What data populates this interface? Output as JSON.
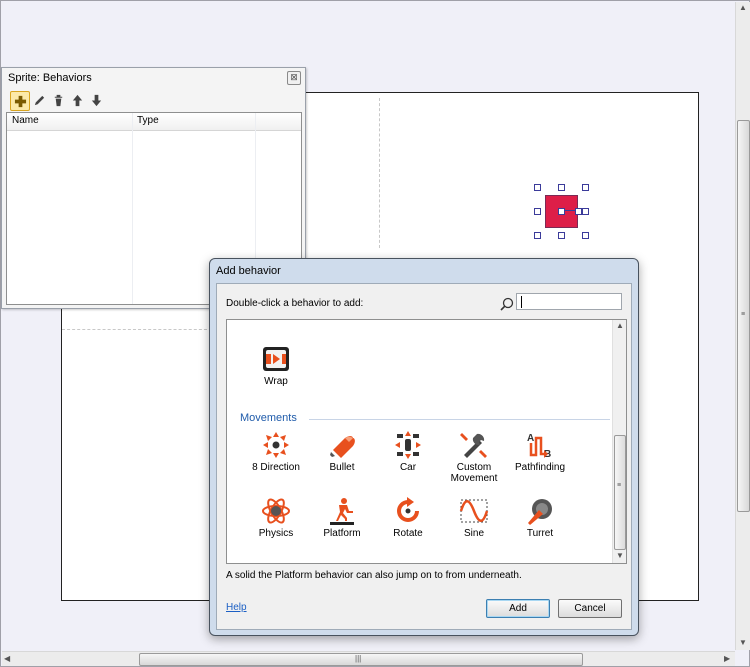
{
  "panel": {
    "title": "Sprite: Behaviors",
    "close_glyph": "⊠",
    "toolbar": [
      {
        "name": "add-icon"
      },
      {
        "name": "edit-icon"
      },
      {
        "name": "delete-icon"
      },
      {
        "name": "move-up-icon"
      },
      {
        "name": "move-down-icon"
      }
    ],
    "columns": [
      "Name",
      "Type"
    ]
  },
  "dialog": {
    "title": "Add behavior",
    "prompt": "Double-click a behavior to add:",
    "search_value": "",
    "top_items": [
      {
        "label": "Wrap",
        "icon": "wrap-icon"
      }
    ],
    "category": "Movements",
    "items": [
      {
        "label": "8 Direction",
        "icon": "eight-direction-icon"
      },
      {
        "label": "Bullet",
        "icon": "bullet-icon"
      },
      {
        "label": "Car",
        "icon": "car-icon"
      },
      {
        "label": "Custom Movement",
        "line1": "Custom",
        "line2": "Movement",
        "icon": "custom-movement-icon"
      },
      {
        "label": "Pathfinding",
        "icon": "pathfinding-icon"
      },
      {
        "label": "Physics",
        "icon": "physics-icon"
      },
      {
        "label": "Platform",
        "icon": "platform-icon"
      },
      {
        "label": "Rotate",
        "icon": "rotate-icon"
      },
      {
        "label": "Sine",
        "icon": "sine-icon"
      },
      {
        "label": "Turret",
        "icon": "turret-icon"
      }
    ],
    "description": "A solid the Platform behavior can also jump on to from underneath.",
    "help_label": "Help",
    "add_label": "Add",
    "cancel_label": "Cancel"
  },
  "colors": {
    "accent_orange": "#e8501e",
    "sprite_fill": "#dd1e48",
    "category_blue": "#1f5baa",
    "link_blue": "#1b5fc4"
  }
}
